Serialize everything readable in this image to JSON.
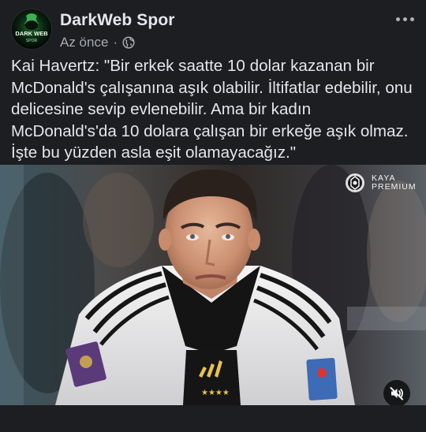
{
  "post": {
    "page_name": "DarkWeb Spor",
    "avatar_text_top": "DARK WEB",
    "avatar_text_bottom": "SPOR",
    "timestamp": "Az önce",
    "separator": "·",
    "privacy_icon": "globe-icon",
    "more_icon": "more-horizontal-icon",
    "text": "Kai Havertz: \"Bir erkek saatte 10 dolar kazanan bir McDonald's çalışanına aşık olabilir. İltifatlar edebilir, onu delicesine sevip evlenebilir. Ama bir kadın McDonald's'da 10 dolara çalışan bir erkeğe aşık olmaz. İşte bu yüzden asla eşit olamayacağız.\""
  },
  "media": {
    "watermark_line1": "KAYA",
    "watermark_line2": "PREMIUM",
    "mute_icon": "speaker-muted-icon"
  },
  "colors": {
    "background": "#1c1e21",
    "text_primary": "#e4e6eb",
    "text_secondary": "#a8abaf",
    "avatar_accent": "#3fbf5a"
  }
}
